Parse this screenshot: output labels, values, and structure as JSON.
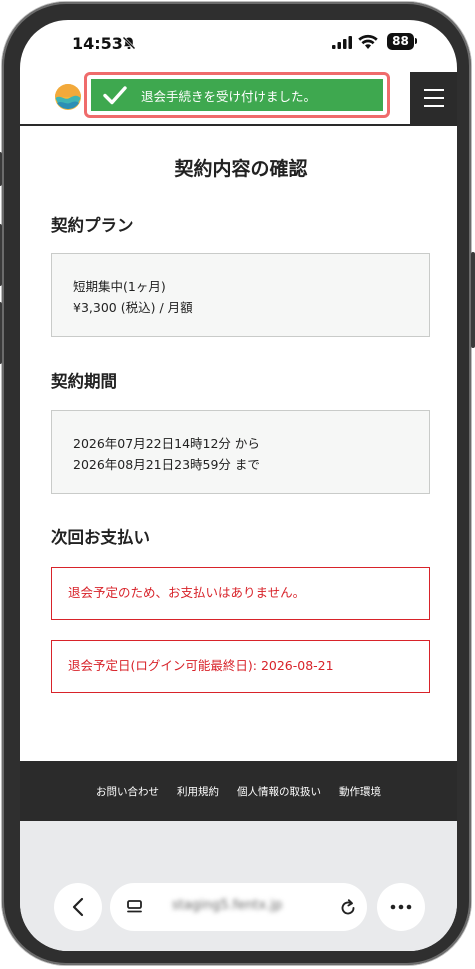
{
  "status_bar": {
    "time": "14:53",
    "battery": "88"
  },
  "toast": {
    "message": "退会手続きを受け付けました。"
  },
  "page": {
    "title": "契約内容の確認"
  },
  "plan": {
    "heading": "契約プラン",
    "name": "短期集中(1ヶ月)",
    "price": "¥3,300 (税込) / 月額"
  },
  "period": {
    "heading": "契約期間",
    "start": "2026年07月22日14時12分 から",
    "end": "2026年08月21日23時59分 まで"
  },
  "payment": {
    "heading": "次回お支払い",
    "notice": "退会予定のため、お支払いはありません。",
    "withdrawal_date": "退会予定日(ログイン可能最終日): 2026-08-21"
  },
  "footer": {
    "links": [
      "お問い合わせ",
      "利用規約",
      "個人情報の取扱い",
      "動作環境"
    ]
  },
  "browser": {
    "url": "staging5.fentx.jp"
  },
  "colors": {
    "toast_bg": "#3ea84f",
    "notice_red": "#d8232a",
    "footer_bg": "#2b2b2b"
  }
}
